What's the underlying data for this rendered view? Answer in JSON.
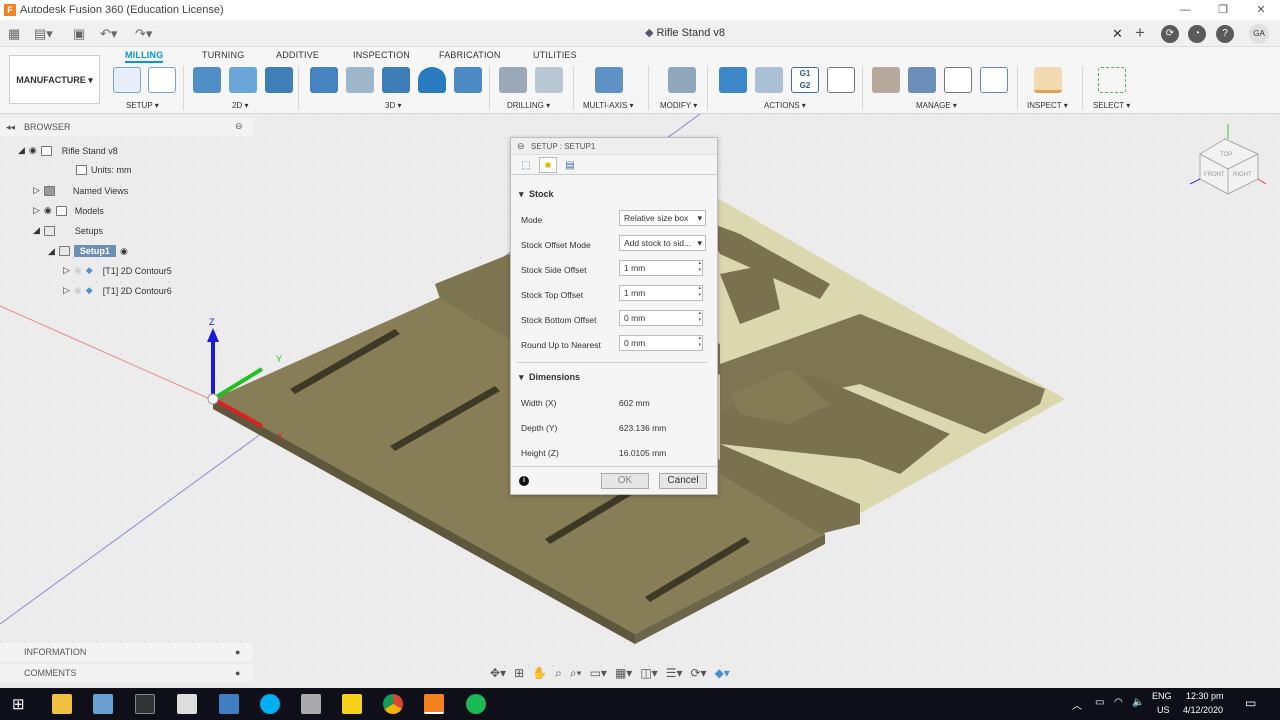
{
  "window": {
    "title": "Autodesk Fusion 360 (Education License)",
    "doc_title": "Rifle Stand v8",
    "user_initials": "GA"
  },
  "ribbon": {
    "tabs": [
      "MILLING",
      "TURNING",
      "ADDITIVE",
      "INSPECTION",
      "FABRICATION",
      "UTILITIES"
    ],
    "active_tab": "MILLING",
    "workspace": "MANUFACTURE",
    "groups": [
      "SETUP",
      "2D",
      "3D",
      "DRILLING",
      "MULTI-AXIS",
      "MODIFY",
      "ACTIONS",
      "MANAGE",
      "INSPECT",
      "SELECT"
    ]
  },
  "browser": {
    "title": "BROWSER",
    "root": "Rifle Stand v8",
    "units": "Units: mm",
    "named_views": "Named Views",
    "models": "Models",
    "setups": "Setups",
    "setup1": "Setup1",
    "ops": [
      "[T1] 2D Contour5",
      "[T1] 2D Contour6"
    ],
    "information": "INFORMATION",
    "comments": "COMMENTS"
  },
  "dialog": {
    "title": "SETUP : SETUP1",
    "stock_section": "Stock",
    "fields": [
      {
        "label": "Mode",
        "value": "Relative size box"
      },
      {
        "label": "Stock Offset Mode",
        "value": "Add stock to sid..."
      },
      {
        "label": "Stock Side Offset",
        "value": "1 mm"
      },
      {
        "label": "Stock Top Offset",
        "value": "1 mm"
      },
      {
        "label": "Stock Bottom Offset",
        "value": "0 mm"
      },
      {
        "label": "Round Up to Nearest",
        "value": "0 mm"
      }
    ],
    "dim_section": "Dimensions",
    "dims": [
      {
        "label": "Width (X)",
        "value": "602 mm"
      },
      {
        "label": "Depth (Y)",
        "value": "623.136 mm"
      },
      {
        "label": "Height (Z)",
        "value": "16.0105 mm"
      }
    ],
    "ok": "OK",
    "cancel": "Cancel"
  },
  "viewcube": {
    "front": "FRONT",
    "right": "RIGHT",
    "top": "TOP"
  },
  "axes": {
    "x": "X",
    "y": "Y",
    "z": "Z"
  },
  "tray": {
    "lang1": "ENG",
    "lang2": "US",
    "time": "12:30 pm",
    "date": "4/12/2020"
  },
  "colors": {
    "accent": "#0696d7",
    "part": "#847a55",
    "stock": "#d8d3a6",
    "setup_sel": "#6d8fb4"
  }
}
